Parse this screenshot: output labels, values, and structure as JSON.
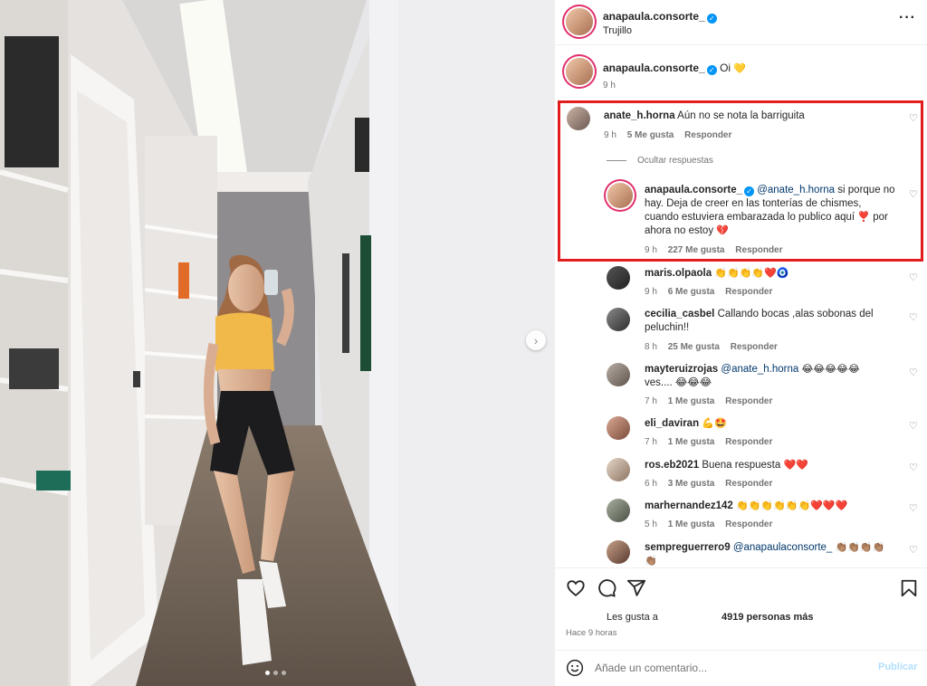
{
  "post": {
    "author": "anapaula.consorte_",
    "location": "Trujillo",
    "caption_text": "Oi",
    "caption_emoji": "💛",
    "caption_time": "9 h"
  },
  "thread": {
    "parent": {
      "user": "anate_h.horna",
      "text": "Aún no se nota la barriguita",
      "time": "9 h",
      "likes": "5 Me gusta",
      "reply": "Responder"
    },
    "hide_replies": "Ocultar respuestas",
    "reply": {
      "user": "anapaula.consorte_",
      "mention": "@anate_h.horna",
      "text": "si porque no hay. Deja de creer en las tonterías de chismes, cuando estuviera embarazada lo publico aquí",
      "emoji1": "❣️",
      "text2": "por ahora no estoy",
      "emoji2": "💔",
      "time": "9 h",
      "likes": "227 Me gusta",
      "reply": "Responder"
    }
  },
  "comments": [
    {
      "user": "maris.olpaola",
      "mention": "",
      "text": "",
      "emoji": "👏👏👏👏❤️🧿",
      "line2": "",
      "time": "9 h",
      "likes": "6 Me gusta",
      "reply": "Responder"
    },
    {
      "user": "cecilia_casbel",
      "mention": "",
      "text": "Callando bocas ,alas sobonas del peluchin!!",
      "emoji": "",
      "line2": "",
      "time": "8 h",
      "likes": "25 Me gusta",
      "reply": "Responder"
    },
    {
      "user": "mayteruizrojas",
      "mention": "@anate_h.horna",
      "text": "",
      "emoji": "😂😂😂😂😂",
      "line2": "ves.... 😂😂😂",
      "time": "7 h",
      "likes": "1 Me gusta",
      "reply": "Responder"
    },
    {
      "user": "eli_daviran",
      "mention": "",
      "text": "",
      "emoji": "💪🤩",
      "line2": "",
      "time": "7 h",
      "likes": "1 Me gusta",
      "reply": "Responder"
    },
    {
      "user": "ros.eb2021",
      "mention": "",
      "text": "Buena respuesta",
      "emoji": "❤️❤️",
      "line2": "",
      "time": "6 h",
      "likes": "3 Me gusta",
      "reply": "Responder"
    },
    {
      "user": "marhernandez142",
      "mention": "",
      "text": "",
      "emoji": "👏👏👏👏👏👏❤️❤️❤️",
      "line2": "",
      "time": "5 h",
      "likes": "1 Me gusta",
      "reply": "Responder"
    },
    {
      "user": "sempreguerrero9",
      "mention": "@anapaulaconsorte_",
      "text": "",
      "emoji": "👏🏽👏🏽👏🏽👏🏽",
      "line2": "👏🏽",
      "time": "",
      "likes": "",
      "reply": ""
    }
  ],
  "engagement": {
    "liked_by_prefix": "Les gusta a",
    "liked_by_count": "4919 personas más",
    "time_ago": "Hace 9 horas"
  },
  "composer": {
    "placeholder": "Añade un comentario...",
    "post_label": "Publicar"
  },
  "icons": [
    "more-icon",
    "verified-icon",
    "heart-icon",
    "comment-icon",
    "share-icon",
    "bookmark-icon",
    "emoji-icon",
    "chevron-right-icon"
  ],
  "colors": {
    "accent": "#0095f6",
    "highlight": "#e11d1d",
    "post_disabled": "#b2dffc"
  }
}
